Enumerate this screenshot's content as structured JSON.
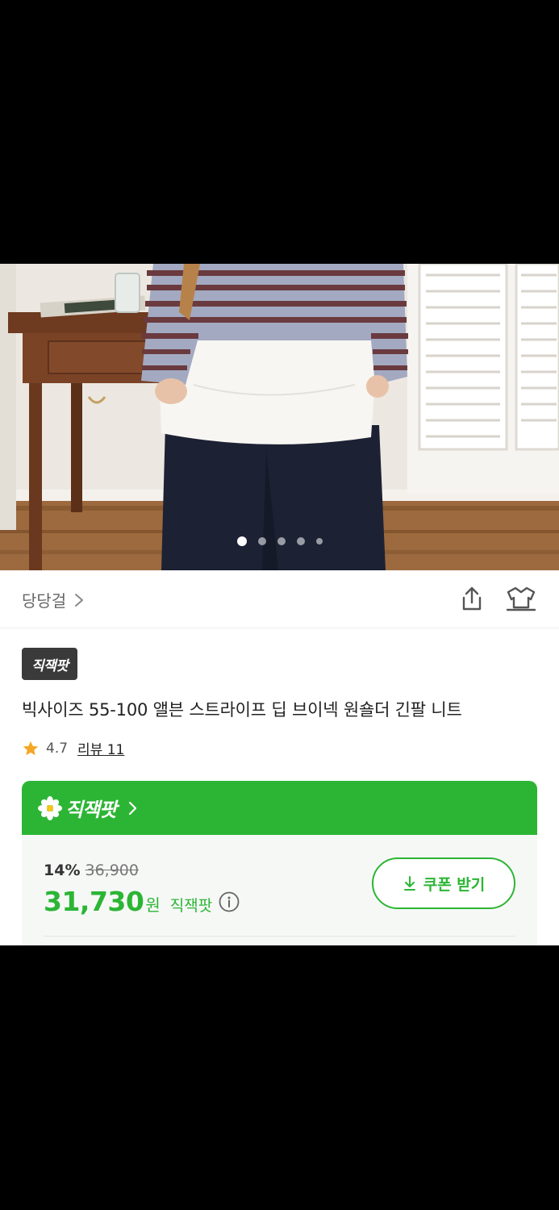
{
  "gallery": {
    "image_alt": "product photo",
    "page_count": 5,
    "current_page": 1
  },
  "store": {
    "name": "당당걸"
  },
  "badge": {
    "label": "직잭팟"
  },
  "product": {
    "title": "빅사이즈 55-100 앨븐 스트라이프 딥 브이넥 원숄더 긴팔 니트",
    "rating": "4.7",
    "review_label": "리뷰 11"
  },
  "deal": {
    "header_label": "직잭팟",
    "discount": "14%",
    "original_price": "36,900",
    "price": "31,730",
    "currency": "원",
    "price_tag": "직잭팟",
    "coupon_label": "쿠폰 받기"
  },
  "colors": {
    "accent_green": "#2cb534",
    "badge_dark": "#3a3a3a",
    "star": "#f5a623"
  },
  "icons": [
    "chevron-right-icon",
    "share-icon",
    "closet-icon",
    "star-icon",
    "flower-icon",
    "info-icon",
    "download-icon"
  ]
}
